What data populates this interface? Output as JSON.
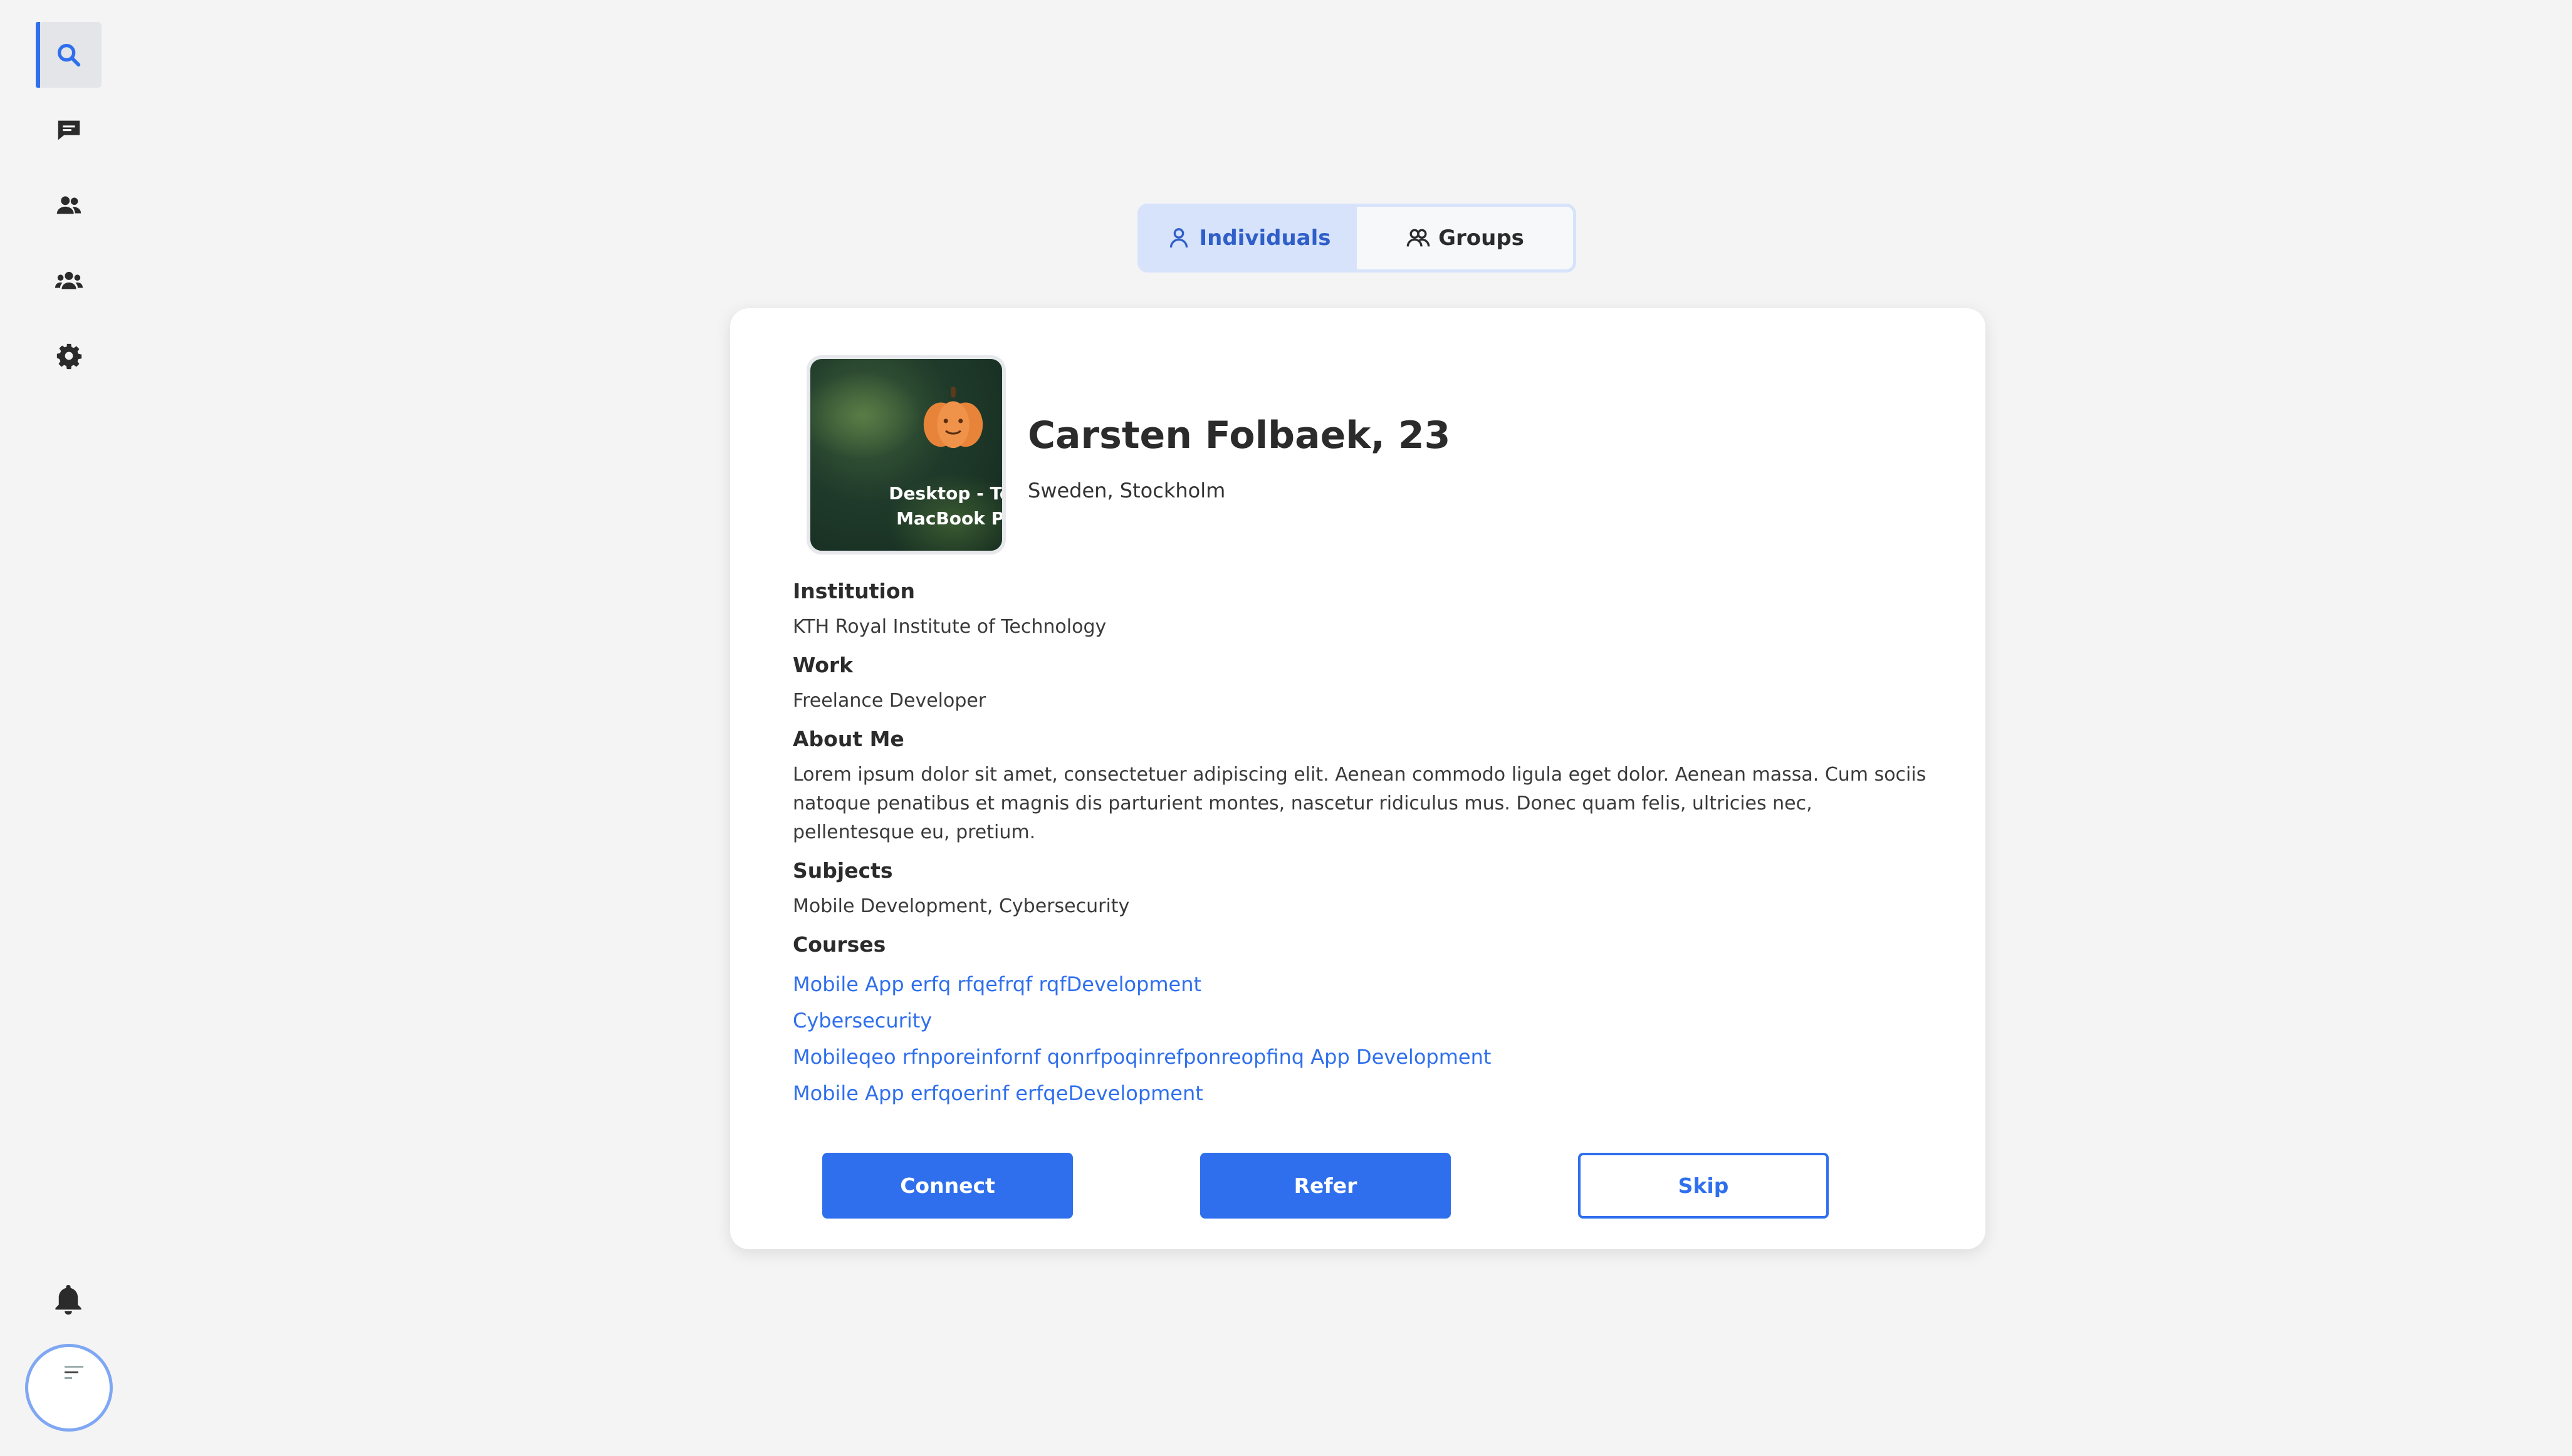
{
  "sidebar": {
    "items": [
      {
        "icon": "search-icon",
        "active": true
      },
      {
        "icon": "chat-icon",
        "active": false
      },
      {
        "icon": "people-icon",
        "active": false
      },
      {
        "icon": "group-icon",
        "active": false
      },
      {
        "icon": "gear-icon",
        "active": false
      }
    ],
    "bottom": {
      "notifications_icon": "bell-icon",
      "profile_icon": "avatar"
    }
  },
  "tabs": {
    "individuals": "Individuals",
    "groups": "Groups",
    "selected": "Individuals"
  },
  "profile": {
    "name": "Carsten Folbaek, 23",
    "location": "Sweden, Stockholm",
    "photo_caption_1": "Desktop - Ter",
    "photo_caption_2": "MacBook Pr",
    "sections": {
      "institution_label": "Institution",
      "institution": "KTH Royal Institute of Technology",
      "work_label": "Work",
      "work": "Freelance Developer",
      "about_label": "About Me",
      "about": "Lorem ipsum dolor sit amet, consectetuer adipiscing elit. Aenean commodo ligula eget dolor. Aenean massa. Cum sociis natoque penatibus et magnis dis parturient montes, nascetur ridiculus mus. Donec quam felis, ultricies nec, pellentesque eu, pretium.",
      "subjects_label": "Subjects",
      "subjects": "Mobile Development, Cybersecurity",
      "courses_label": "Courses",
      "courses": [
        "Mobile App erfq rfqefrqf rqfDevelopment",
        "Cybersecurity",
        "Mobileqeo rfnporeinfornf qonrfpoqinrefponreopfinq App Development",
        "Mobile App erfqoerinf erfqeDevelopment"
      ]
    }
  },
  "actions": {
    "connect": "Connect",
    "refer": "Refer",
    "skip": "Skip"
  },
  "colors": {
    "accent": "#2f6fed",
    "toggle_selected_bg": "#d7e2fb",
    "page_bg": "#f4f4f4"
  }
}
